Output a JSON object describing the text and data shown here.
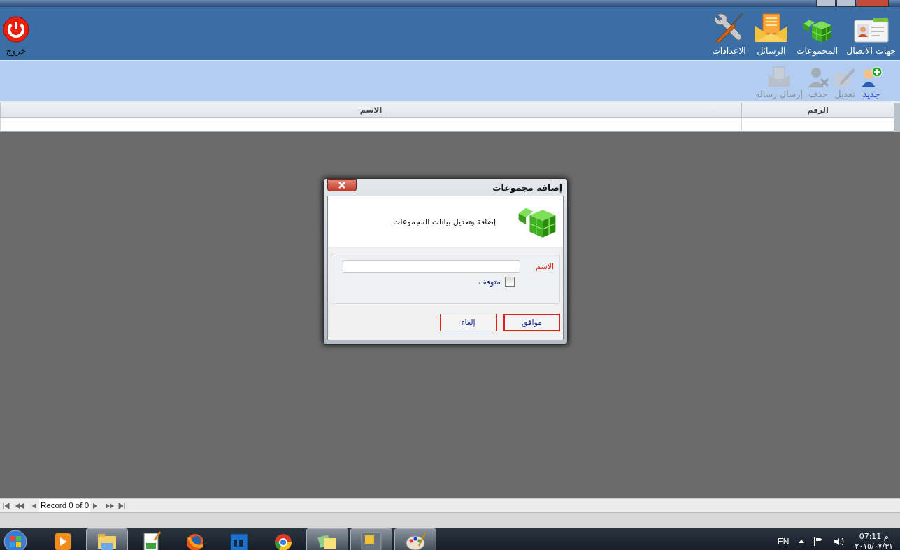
{
  "ribbon": {
    "exit": {
      "label": "خروج"
    },
    "items": [
      {
        "kind": "contacts",
        "label": "جهات الاتصال"
      },
      {
        "kind": "groups",
        "label": "المجموعات"
      },
      {
        "kind": "messages",
        "label": "الرسائل"
      },
      {
        "kind": "settings",
        "label": "الاعدادات"
      }
    ]
  },
  "toolbar": [
    {
      "kind": "new",
      "label": "جديد",
      "disabled": false
    },
    {
      "kind": "edit",
      "label": "تعديل",
      "disabled": true
    },
    {
      "kind": "delete",
      "label": "حذف",
      "disabled": true
    },
    {
      "kind": "send",
      "label": "إرسال رساله",
      "disabled": true
    }
  ],
  "table": {
    "columns": [
      "الرقم",
      "الاسم"
    ]
  },
  "navigator": {
    "record": "Record 0 of 0"
  },
  "dialog": {
    "title": "إضافة مجموعات",
    "header": "إضافة وتعديل بيانات المجموعات.",
    "name_label": "الاسم",
    "stopped": {
      "label": "متوقف",
      "checked": false
    },
    "buttons": [
      {
        "label": "موافق",
        "default": true
      },
      {
        "label": "إلغاء",
        "default": false
      }
    ]
  },
  "taskbar": {
    "apps": [
      {
        "kind": "media",
        "running": false
      },
      {
        "kind": "explorer",
        "running": true
      },
      {
        "kind": "notepad",
        "running": false
      },
      {
        "kind": "firefox",
        "running": false
      },
      {
        "kind": "photoshop",
        "running": false
      },
      {
        "kind": "chrome",
        "running": false
      },
      {
        "kind": "notes",
        "running": true
      },
      {
        "kind": "app",
        "running": true
      },
      {
        "kind": "paint",
        "running": true
      }
    ],
    "language": "EN",
    "time": "07:11 م",
    "date": "٢٠١٥/٠٧/٣١"
  }
}
